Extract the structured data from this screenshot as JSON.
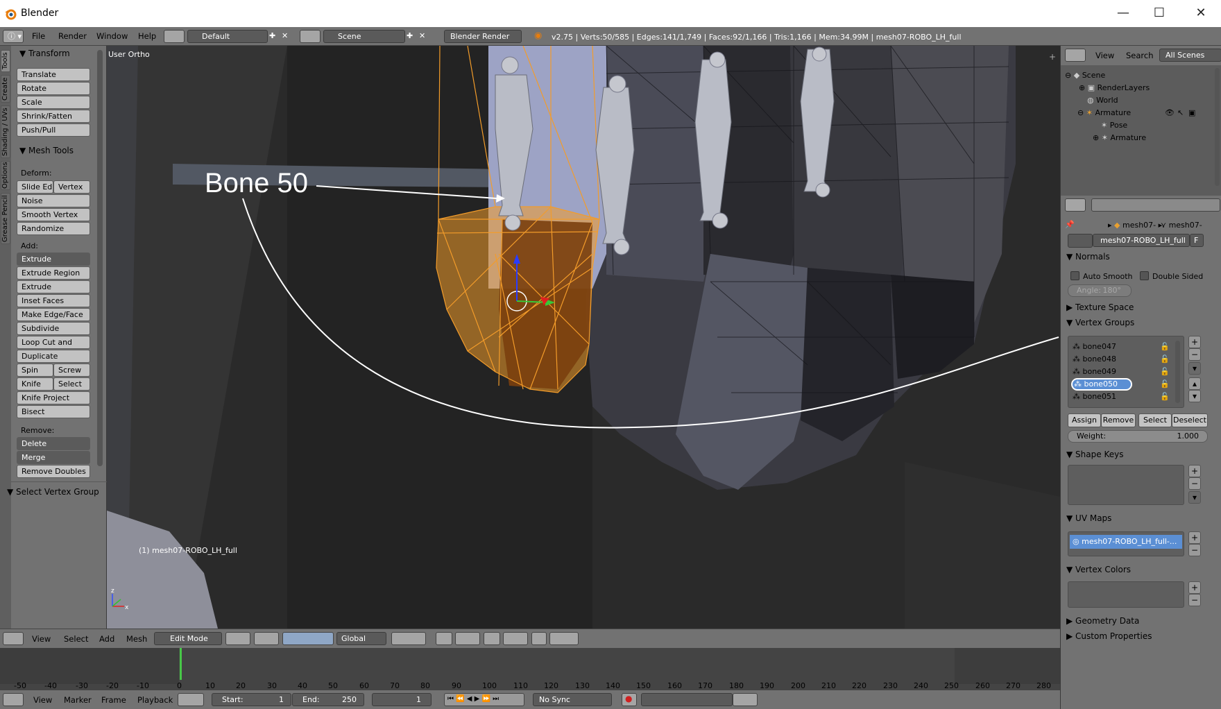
{
  "window": {
    "title": "Blender",
    "minimize": "—",
    "maximize": "☐",
    "close": "✕"
  },
  "info_header": {
    "menus": [
      "File",
      "Render",
      "Window",
      "Help"
    ],
    "layout": "Default",
    "scene": "Scene",
    "engine": "Blender Render",
    "stats": "v2.75 | Verts:50/585 | Edges:141/1,749 | Faces:92/1,166 | Tris:1,166 | Mem:34.99M | mesh07-ROBO_LH_full"
  },
  "tool_tabs": [
    "Tools",
    "Create",
    "Shading / UVs",
    "Options",
    "Grease Pencil"
  ],
  "toolshelf": {
    "transform": {
      "header": "Transform",
      "buttons": [
        "Translate",
        "Rotate",
        "Scale",
        "Shrink/Fatten",
        "Push/Pull"
      ]
    },
    "mesh_tools": {
      "header": "Mesh Tools",
      "deform_label": "Deform:",
      "slide_edge": "Slide Ed",
      "vertex": "Vertex",
      "noise": "Noise",
      "smooth_vertex": "Smooth Vertex",
      "randomize": "Randomize",
      "add_label": "Add:",
      "extrude": "Extrude",
      "extrude_region": "Extrude Region",
      "extrude_individual": "Extrude Individual",
      "inset_faces": "Inset Faces",
      "make_edge_face": "Make Edge/Face",
      "subdivide": "Subdivide",
      "loop_cut": "Loop Cut and Slide",
      "duplicate": "Duplicate",
      "spin": "Spin",
      "screw": "Screw",
      "knife": "Knife",
      "select": "Select",
      "knife_project": "Knife Project",
      "bisect": "Bisect",
      "remove_label": "Remove:",
      "delete": "Delete",
      "merge": "Merge",
      "remove_doubles": "Remove Doubles"
    },
    "operator_panel": "Select Vertex Group"
  },
  "viewport": {
    "view_name": "User Ortho",
    "object_label": "(1) mesh07-ROBO_LH_full",
    "annotation": "Bone 50"
  },
  "viewport_header": {
    "menus": [
      "View",
      "Select",
      "Add",
      "Mesh"
    ],
    "mode": "Edit Mode",
    "orientation": "Global"
  },
  "timeline": {
    "ticks": [
      "-50",
      "-40",
      "-30",
      "-20",
      "-10",
      "0",
      "10",
      "20",
      "30",
      "40",
      "50",
      "60",
      "70",
      "80",
      "90",
      "100",
      "110",
      "120",
      "130",
      "140",
      "150",
      "160",
      "170",
      "180",
      "190",
      "200",
      "210",
      "220",
      "230",
      "240",
      "250",
      "260",
      "270",
      "280"
    ],
    "menus": [
      "View",
      "Marker",
      "Frame",
      "Playback"
    ],
    "start_label": "Start:",
    "start": "1",
    "end_label": "End:",
    "end": "250",
    "current": "1",
    "sync": "No Sync"
  },
  "outliner": {
    "menus": [
      "View",
      "Search"
    ],
    "filter": "All Scenes",
    "items": [
      {
        "label": "Scene",
        "indent": 0
      },
      {
        "label": "RenderLayers",
        "indent": 1
      },
      {
        "label": "World",
        "indent": 1
      },
      {
        "label": "Armature",
        "indent": 1
      },
      {
        "label": "Pose",
        "indent": 2
      },
      {
        "label": "Armature",
        "indent": 2
      }
    ]
  },
  "properties": {
    "breadcrumb_1": "mesh07-",
    "breadcrumb_2": "mesh07-",
    "datablock": "mesh07-ROBO_LH_full",
    "datablock_f": "F",
    "normals": {
      "header": "Normals",
      "auto_smooth": "Auto Smooth",
      "double_sided": "Double Sided",
      "angle": "Angle:",
      "angle_value": "180°"
    },
    "texture_space": "Texture Space",
    "vertex_groups": {
      "header": "Vertex Groups",
      "items": [
        "bone047",
        "bone048",
        "bone049",
        "bone050",
        "bone051"
      ],
      "active": "bone050",
      "assign": "Assign",
      "remove": "Remove",
      "select": "Select",
      "deselect": "Deselect",
      "weight_label": "Weight:",
      "weight": "1.000"
    },
    "shape_keys": "Shape Keys",
    "uv_maps": {
      "header": "UV Maps",
      "item": "mesh07-ROBO_LH_full-..."
    },
    "vertex_colors": "Vertex Colors",
    "geometry_data": "Geometry Data",
    "custom_properties": "Custom Properties"
  },
  "colors": {
    "selection": "#f39c2a",
    "active_item": "#5b8fd4",
    "annotation": "#ffffff"
  }
}
